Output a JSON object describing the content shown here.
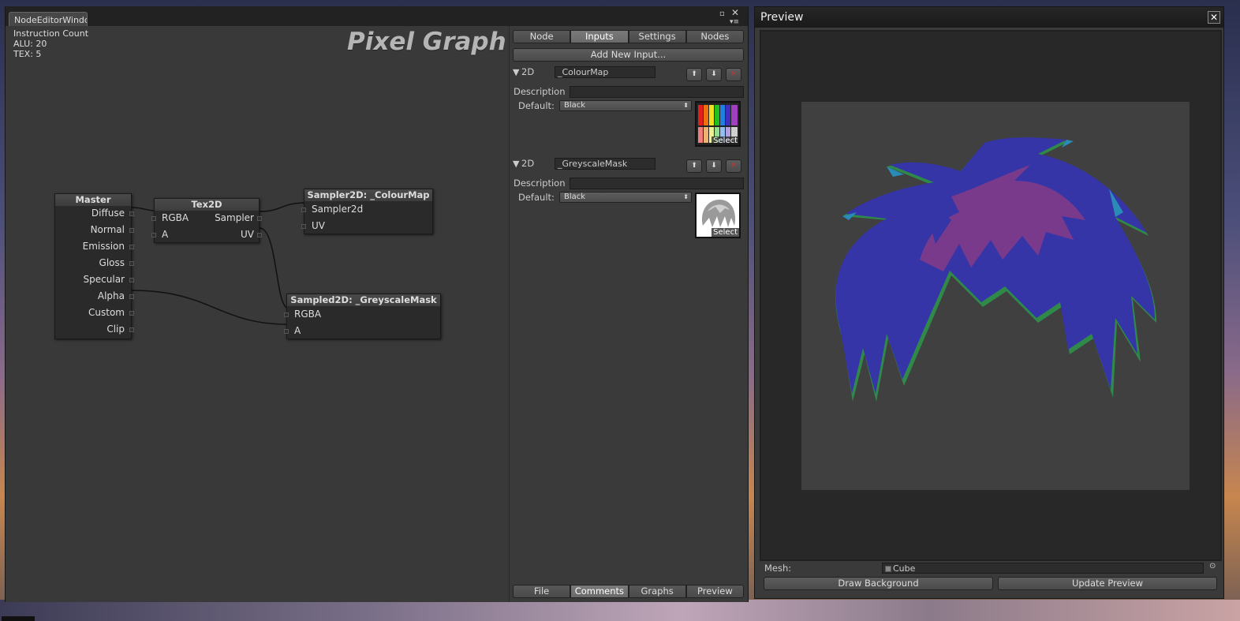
{
  "editor": {
    "window_tab": "NodeEditorWindow",
    "stats": {
      "instruction_count": "Instruction Count",
      "alu": "ALU: 20",
      "tex": "TEX: 5"
    },
    "graph_title": "Pixel Graph",
    "nodes": {
      "master": {
        "title": "Master",
        "inputs": [
          "Diffuse",
          "Normal",
          "Emission",
          "Gloss",
          "Specular",
          "Alpha",
          "Custom",
          "Clip"
        ]
      },
      "tex2d": {
        "title": "Tex2D",
        "left": [
          "RGBA",
          "A"
        ],
        "right": [
          "Sampler",
          "UV"
        ]
      },
      "sampler2d": {
        "title": "Sampler2D: _ColourMap",
        "ports": [
          "Sampler2d",
          "UV"
        ]
      },
      "sampled2d": {
        "title": "Sampled2D: _GreyscaleMask",
        "ports": [
          "RGBA",
          "A"
        ]
      }
    }
  },
  "panel": {
    "top_tabs": [
      "Node",
      "Inputs",
      "Settings",
      "Nodes"
    ],
    "active_top_tab": "Inputs",
    "add_input_label": "Add New Input...",
    "inputs": [
      {
        "type": "2D",
        "name": "_ColourMap",
        "description_label": "Description",
        "description_value": "",
        "default_label": "Default:",
        "default_value": "Black",
        "select_label": "Select"
      },
      {
        "type": "2D",
        "name": "_GreyscaleMask",
        "description_label": "Description",
        "description_value": "",
        "default_label": "Default:",
        "default_value": "Black",
        "select_label": "Select"
      }
    ],
    "bottom_tabs": [
      "File",
      "Comments",
      "Graphs",
      "Preview"
    ],
    "active_bottom_tab": "Comments"
  },
  "preview": {
    "title": "Preview",
    "mesh_label": "Mesh:",
    "mesh_value": "Cube",
    "draw_background_label": "Draw Background",
    "update_preview_label": "Update Preview"
  },
  "colors": {
    "hair_blue": "#3535a8",
    "hair_magenta": "#7a3a8c",
    "hair_edge_green": "#2f8a4a",
    "hair_edge_cyan": "#2a8ab8",
    "wire": "#111111"
  },
  "icons": [
    "close-icon",
    "maximize-icon",
    "menu-icon",
    "foldout-arrow-icon",
    "move-up-icon",
    "move-down-icon",
    "delete-icon",
    "dropdown-arrow-icon",
    "mesh-object-icon",
    "object-picker-icon"
  ]
}
